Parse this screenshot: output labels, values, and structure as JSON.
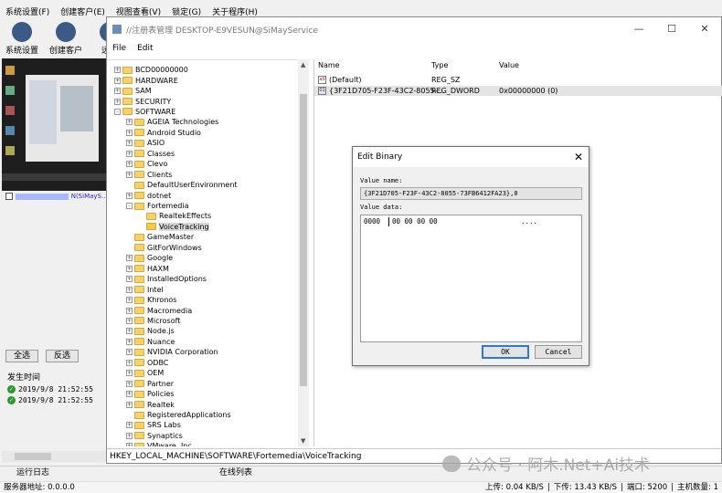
{
  "app": {
    "menu": [
      "系统设置(F)",
      "创建客户(E)",
      "视图查看(V)",
      "锁定(G)",
      "关于程序(H)"
    ],
    "toolbar": [
      "系统设置",
      "创建客户",
      "远程"
    ],
    "host_suffix": "N(SiMayS…",
    "select_all": "全选",
    "invert_select": "反选",
    "time_header": "发生时间",
    "logs": [
      "2019/9/8 21:52:55",
      "2019/9/8 21:52:55"
    ],
    "tabs": [
      "运行日志",
      "在线列表"
    ],
    "status": {
      "server_label": "服务器地址:",
      "server_value": "0.0.0.0",
      "upload": "上传: 0.04 KB/S",
      "download": "下传: 13.43 KB/S",
      "port": "端口: 5200",
      "hosts": "主机数量: 1"
    }
  },
  "regwin": {
    "title": "//注册表管理 DESKTOP-E9VESUN@SiMayService",
    "controls": [
      "—",
      "☐",
      "✕"
    ],
    "menu": [
      "File",
      "Edit"
    ],
    "tree": [
      {
        "label": "BCD00000000",
        "indent": 1,
        "exp": "+"
      },
      {
        "label": "HARDWARE",
        "indent": 1,
        "exp": "+"
      },
      {
        "label": "SAM",
        "indent": 1,
        "exp": "+"
      },
      {
        "label": "SECURITY",
        "indent": 1,
        "exp": "+"
      },
      {
        "label": "SOFTWARE",
        "indent": 1,
        "exp": "-"
      },
      {
        "label": "AGEIA Technologies",
        "indent": 2,
        "exp": "+"
      },
      {
        "label": "Android Studio",
        "indent": 2,
        "exp": "+"
      },
      {
        "label": "ASIO",
        "indent": 2,
        "exp": "+"
      },
      {
        "label": "Classes",
        "indent": 2,
        "exp": "+"
      },
      {
        "label": "Clevo",
        "indent": 2,
        "exp": "+"
      },
      {
        "label": "Clients",
        "indent": 2,
        "exp": "+"
      },
      {
        "label": "DefaultUserEnvironment",
        "indent": 2,
        "exp": ""
      },
      {
        "label": "dotnet",
        "indent": 2,
        "exp": "+"
      },
      {
        "label": "Fortemedia",
        "indent": 2,
        "exp": "-"
      },
      {
        "label": "RealtekEffects",
        "indent": 3,
        "exp": ""
      },
      {
        "label": "VoiceTracking",
        "indent": 3,
        "exp": "",
        "selected": true
      },
      {
        "label": "GameMaster",
        "indent": 2,
        "exp": ""
      },
      {
        "label": "GitForWindows",
        "indent": 2,
        "exp": ""
      },
      {
        "label": "Google",
        "indent": 2,
        "exp": "+"
      },
      {
        "label": "HAXM",
        "indent": 2,
        "exp": "+"
      },
      {
        "label": "InstalledOptions",
        "indent": 2,
        "exp": "+"
      },
      {
        "label": "Intel",
        "indent": 2,
        "exp": "+"
      },
      {
        "label": "Khronos",
        "indent": 2,
        "exp": "+"
      },
      {
        "label": "Macromedia",
        "indent": 2,
        "exp": "+"
      },
      {
        "label": "Microsoft",
        "indent": 2,
        "exp": "+"
      },
      {
        "label": "Node.js",
        "indent": 2,
        "exp": "+"
      },
      {
        "label": "Nuance",
        "indent": 2,
        "exp": "+"
      },
      {
        "label": "NVIDIA Corporation",
        "indent": 2,
        "exp": "+"
      },
      {
        "label": "ODBC",
        "indent": 2,
        "exp": "+"
      },
      {
        "label": "OEM",
        "indent": 2,
        "exp": "+"
      },
      {
        "label": "Partner",
        "indent": 2,
        "exp": "+"
      },
      {
        "label": "Policies",
        "indent": 2,
        "exp": "+"
      },
      {
        "label": "Realtek",
        "indent": 2,
        "exp": "+"
      },
      {
        "label": "RegisteredApplications",
        "indent": 2,
        "exp": ""
      },
      {
        "label": "SRS Labs",
        "indent": 2,
        "exp": "+"
      },
      {
        "label": "Synaptics",
        "indent": 2,
        "exp": "+"
      },
      {
        "label": "VMware, Inc.",
        "indent": 2,
        "exp": "+"
      }
    ],
    "columns": [
      "Name",
      "Type",
      "Value"
    ],
    "values": [
      {
        "name": "(Default)",
        "type": "REG_SZ",
        "value": "",
        "icon": "ab"
      },
      {
        "name": "{3F21D705-F23F-43C2-8055-…",
        "type": "REG_DWORD",
        "value": "0x00000000 (0)",
        "icon": "01",
        "selected": true
      }
    ],
    "path": "HKEY_LOCAL_MACHINE\\SOFTWARE\\Fortemedia\\VoiceTracking"
  },
  "dialog": {
    "title": "Edit Binary",
    "close": "✕",
    "value_name_label": "Value name:",
    "value_name": "{3F21D705-F23F-43C2-8055-73FB6412FA23},0",
    "value_data_label": "Value data:",
    "offset": "0000",
    "hex": "00 00 00 00",
    "ascii": "....",
    "ok": "OK",
    "cancel": "Cancel"
  },
  "watermark": "公众号 · 阿木.Net+Ai技术"
}
